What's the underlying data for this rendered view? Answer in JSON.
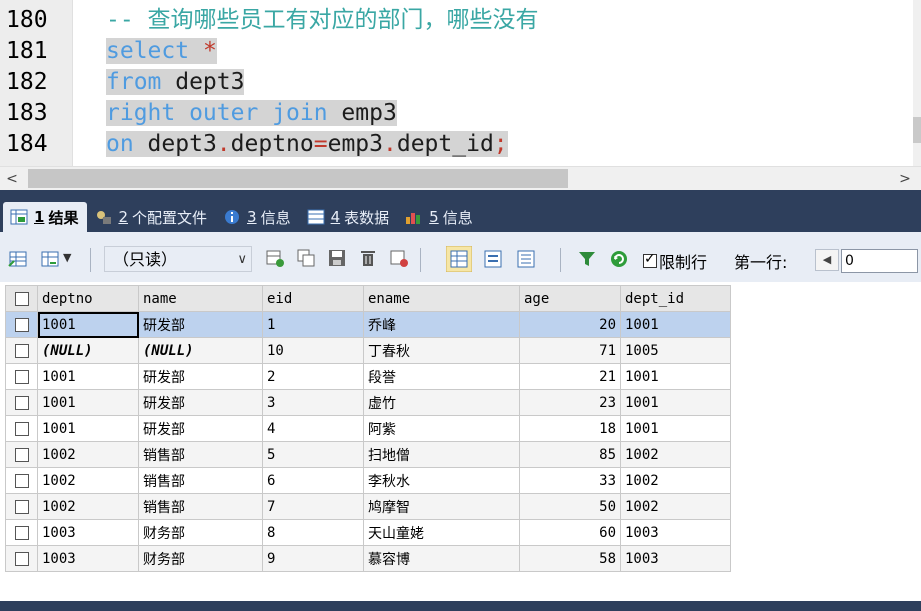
{
  "editor": {
    "lines": [
      {
        "num": "180",
        "parts": [
          {
            "t": "-- 查询哪些员工有对应的部门，哪些没有",
            "c": "comment",
            "sel": false
          }
        ]
      },
      {
        "num": "181",
        "parts": [
          {
            "t": "select",
            "c": "kw",
            "sel": true
          },
          {
            "t": " ",
            "c": "plain",
            "sel": true
          },
          {
            "t": "*",
            "c": "punc",
            "sel": true
          }
        ]
      },
      {
        "num": "182",
        "parts": [
          {
            "t": "from",
            "c": "kw",
            "sel": true
          },
          {
            "t": " dept3",
            "c": "plain",
            "sel": true
          }
        ]
      },
      {
        "num": "183",
        "parts": [
          {
            "t": "right outer join",
            "c": "kw",
            "sel": true
          },
          {
            "t": " emp3",
            "c": "plain",
            "sel": true
          }
        ]
      },
      {
        "num": "184",
        "parts": [
          {
            "t": "on",
            "c": "kw",
            "sel": true
          },
          {
            "t": " dept3",
            "c": "plain",
            "sel": true
          },
          {
            "t": ".",
            "c": "punc",
            "sel": true
          },
          {
            "t": "deptno",
            "c": "plain",
            "sel": true
          },
          {
            "t": "=",
            "c": "punc",
            "sel": true
          },
          {
            "t": "emp3",
            "c": "plain",
            "sel": true
          },
          {
            "t": ".",
            "c": "punc",
            "sel": true
          },
          {
            "t": "dept_id",
            "c": "plain",
            "sel": true
          },
          {
            "t": ";",
            "c": "punc",
            "sel": true
          }
        ]
      }
    ],
    "scroll_left_glyph": "<",
    "scroll_right_glyph": ">"
  },
  "tabs": [
    {
      "num": "1",
      "label": "结果",
      "icon": "result-grid-icon",
      "active": true
    },
    {
      "num": "2",
      "label": "个配置文件",
      "icon": "profile-icon",
      "active": false
    },
    {
      "num": "3",
      "label": "信息",
      "icon": "info-icon",
      "active": false
    },
    {
      "num": "4",
      "label": "表数据",
      "icon": "table-data-icon",
      "active": false
    },
    {
      "num": "5",
      "label": "信息",
      "icon": "history-icon",
      "active": false
    }
  ],
  "toolbar": {
    "mode_select": "（只读）",
    "limit_label": "限制行",
    "limit_checked": true,
    "first_row_label": "第一行:",
    "first_row_value": "0"
  },
  "grid": {
    "columns": [
      "deptno",
      "name",
      "eid",
      "ename",
      "age",
      "dept_id"
    ],
    "rows": [
      [
        "1001",
        "研发部",
        "1",
        "乔峰",
        "20",
        "1001"
      ],
      [
        "(NULL)",
        "(NULL)",
        "10",
        "丁春秋",
        "71",
        "1005"
      ],
      [
        "1001",
        "研发部",
        "2",
        "段誉",
        "21",
        "1001"
      ],
      [
        "1001",
        "研发部",
        "3",
        "虚竹",
        "23",
        "1001"
      ],
      [
        "1001",
        "研发部",
        "4",
        "阿紫",
        "18",
        "1001"
      ],
      [
        "1002",
        "销售部",
        "5",
        "扫地僧",
        "85",
        "1002"
      ],
      [
        "1002",
        "销售部",
        "6",
        "李秋水",
        "33",
        "1002"
      ],
      [
        "1002",
        "销售部",
        "7",
        "鸠摩智",
        "50",
        "1002"
      ],
      [
        "1003",
        "财务部",
        "8",
        "天山童姥",
        "60",
        "1003"
      ],
      [
        "1003",
        "财务部",
        "9",
        "慕容博",
        "58",
        "1003"
      ]
    ],
    "selected_row": 0
  },
  "colors": {
    "band": "#2e3f5c",
    "toolbar_bg": "#e8edf5",
    "selected_row": "#bdd2ee",
    "keyword": "#4f9be0",
    "comment": "#3aa7a4"
  }
}
